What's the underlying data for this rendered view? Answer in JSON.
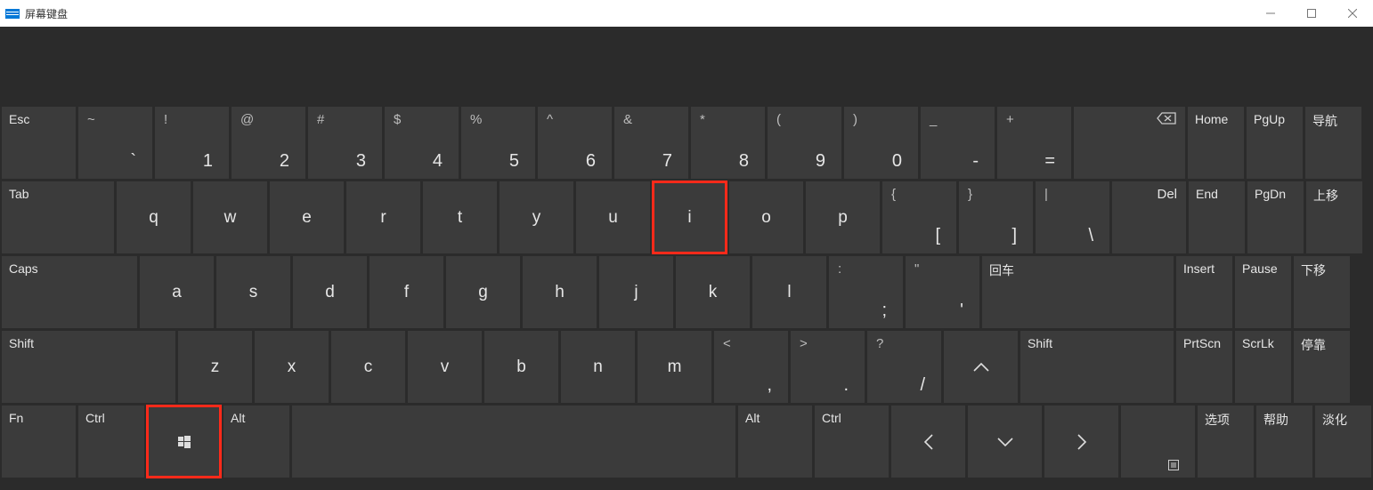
{
  "titlebar": {
    "title": "屏幕键盘"
  },
  "row1": {
    "esc": "Esc",
    "tilde": {
      "u": "~",
      "l": "`"
    },
    "n1": {
      "u": "!",
      "l": "1"
    },
    "n2": {
      "u": "@",
      "l": "2"
    },
    "n3": {
      "u": "#",
      "l": "3"
    },
    "n4": {
      "u": "$",
      "l": "4"
    },
    "n5": {
      "u": "%",
      "l": "5"
    },
    "n6": {
      "u": "^",
      "l": "6"
    },
    "n7": {
      "u": "&",
      "l": "7"
    },
    "n8": {
      "u": "*",
      "l": "8"
    },
    "n9": {
      "u": "(",
      "l": "9"
    },
    "n0": {
      "u": ")",
      "l": "0"
    },
    "minus": {
      "u": "_",
      "l": "-"
    },
    "equals": {
      "u": "+",
      "l": "="
    },
    "home": "Home",
    "pgup": "PgUp",
    "nav": "导航"
  },
  "row2": {
    "tab": "Tab",
    "q": "q",
    "w": "w",
    "e": "e",
    "r": "r",
    "t": "t",
    "y": "y",
    "u": "u",
    "i": "i",
    "o": "o",
    "p": "p",
    "lb": {
      "u": "{",
      "l": "["
    },
    "rb": {
      "u": "}",
      "l": "]"
    },
    "bs": {
      "u": "|",
      "l": "\\"
    },
    "del": "Del",
    "end": "End",
    "pgdn": "PgDn",
    "up": "上移"
  },
  "row3": {
    "caps": "Caps",
    "a": "a",
    "s": "s",
    "d": "d",
    "f": "f",
    "g": "g",
    "h": "h",
    "j": "j",
    "k": "k",
    "l": "l",
    "semi": {
      "u": ":",
      "l": ";"
    },
    "quote": {
      "u": "\"",
      "l": "'"
    },
    "enter": "回车",
    "insert": "Insert",
    "pause": "Pause",
    "down": "下移"
  },
  "row4": {
    "shift": "Shift",
    "z": "z",
    "x": "x",
    "c": "c",
    "v": "v",
    "b": "b",
    "n": "n",
    "m": "m",
    "comma": {
      "u": "<",
      "l": ","
    },
    "period": {
      "u": ">",
      "l": "."
    },
    "slash": {
      "u": "?",
      "l": "/"
    },
    "rshift": "Shift",
    "prtscn": "PrtScn",
    "scrlk": "ScrLk",
    "dock": "停靠"
  },
  "row5": {
    "fn": "Fn",
    "ctrl": "Ctrl",
    "alt": "Alt",
    "ralt": "Alt",
    "rctrl": "Ctrl",
    "options": "选项",
    "help": "帮助",
    "fade": "淡化"
  }
}
